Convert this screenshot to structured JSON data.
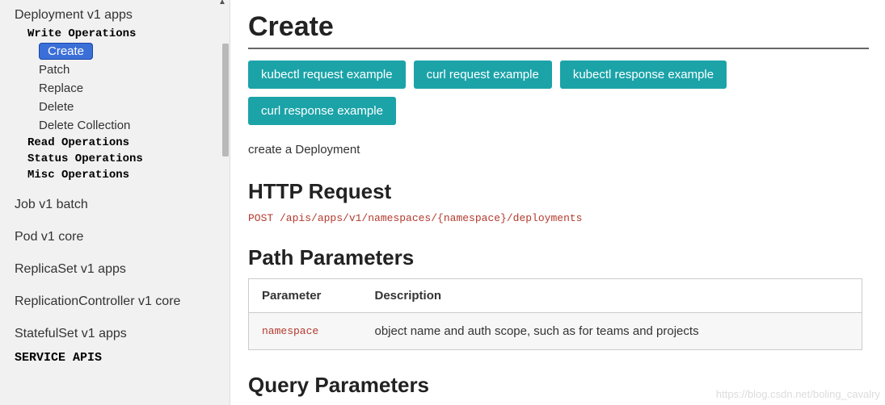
{
  "sidebar": {
    "resource_expanded": "Deployment v1 apps",
    "groups": [
      {
        "label": "Write Operations",
        "ops": [
          {
            "label": "Create",
            "active": true
          },
          {
            "label": "Patch",
            "active": false
          },
          {
            "label": "Replace",
            "active": false
          },
          {
            "label": "Delete",
            "active": false
          },
          {
            "label": "Delete Collection",
            "active": false
          }
        ]
      },
      {
        "label": "Read Operations",
        "ops": []
      },
      {
        "label": "Status Operations",
        "ops": []
      },
      {
        "label": "Misc Operations",
        "ops": []
      }
    ],
    "resources": [
      "Job v1 batch",
      "Pod v1 core",
      "ReplicaSet v1 apps",
      "ReplicationController v1 core",
      "StatefulSet v1 apps"
    ],
    "category": "SERVICE APIS"
  },
  "main": {
    "title": "Create",
    "buttons": [
      "kubectl request example",
      "curl request example",
      "kubectl response example",
      "curl response example"
    ],
    "description": "create a Deployment",
    "http_heading": "HTTP Request",
    "http_line": "POST /apis/apps/v1/namespaces/{namespace}/deployments",
    "path_heading": "Path Parameters",
    "path_table": {
      "headers": [
        "Parameter",
        "Description"
      ],
      "rows": [
        {
          "param": "namespace",
          "desc": "object name and auth scope, such as for teams and projects"
        }
      ]
    },
    "query_heading": "Query Parameters"
  },
  "watermark": "https://blog.csdn.net/boling_cavalry"
}
